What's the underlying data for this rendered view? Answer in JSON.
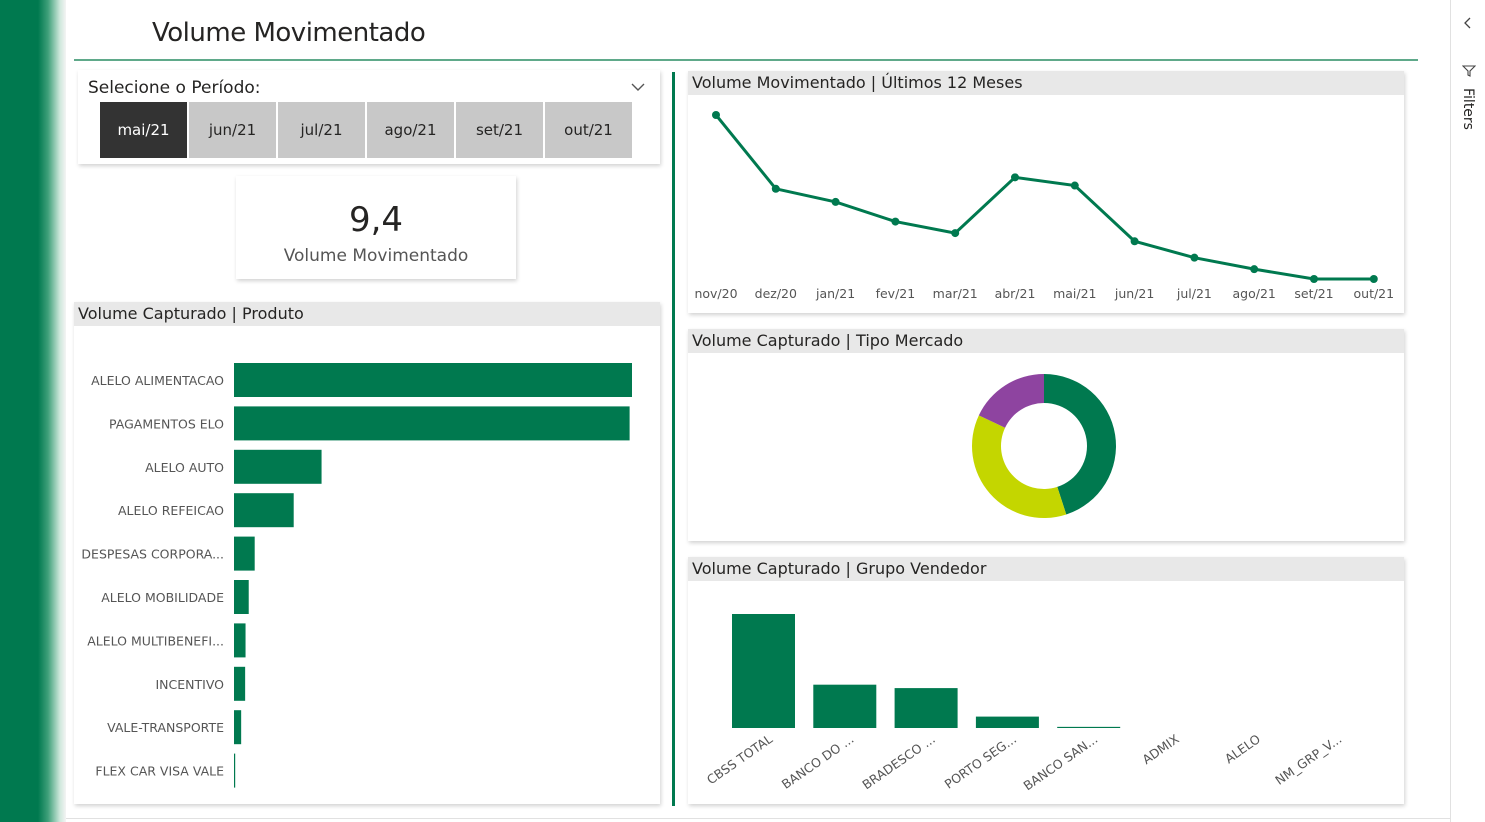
{
  "page": {
    "title": "Volume Movimentado"
  },
  "period_slicer": {
    "label": "Selecione o Período:",
    "options": [
      "mai/21",
      "jun/21",
      "jul/21",
      "ago/21",
      "set/21",
      "out/21"
    ],
    "selected": "mai/21"
  },
  "kpi": {
    "value": "9,4",
    "label": "Volume Movimentado"
  },
  "filters_pane": {
    "label": "Filters"
  },
  "colors": {
    "brand": "#00794f",
    "yellow_green": "#c4d600",
    "purple": "#8e44a0",
    "selected_button": "#333333"
  },
  "chart_data": [
    {
      "type": "bar",
      "orientation": "horizontal",
      "title": "Volume Capturado | Produto",
      "categories": [
        "ALELO ALIMENTACAO",
        "PAGAMENTOS ELO",
        "ALELO AUTO",
        "ALELO REFEICAO",
        "DESPESAS CORPORA...",
        "ALELO MOBILIDADE",
        "ALELO MULTIBENEFI...",
        "INCENTIVO",
        "VALE-TRANSPORTE",
        "FLEX CAR VISA VALE"
      ],
      "values": [
        100,
        99.4,
        22,
        15,
        5.2,
        3.7,
        2.9,
        2.8,
        1.8,
        0.3
      ],
      "xlim": [
        0,
        100
      ]
    },
    {
      "type": "line",
      "title": "Volume Movimentado | Últimos 12 Meses",
      "x": [
        "nov/20",
        "dez/20",
        "jan/21",
        "fev/21",
        "mar/21",
        "abr/21",
        "mai/21",
        "jun/21",
        "jul/21",
        "ago/21",
        "set/21",
        "out/21"
      ],
      "values": [
        100,
        55,
        47,
        35,
        28,
        62,
        57,
        23,
        13,
        6,
        0,
        0
      ],
      "ylim": [
        0,
        100
      ]
    },
    {
      "type": "pie",
      "subtype": "donut",
      "title": "Volume Capturado | Tipo Mercado",
      "slices": [
        {
          "value": 45,
          "color": "#00794f"
        },
        {
          "value": 37,
          "color": "#c4d600"
        },
        {
          "value": 18,
          "color": "#8e44a0"
        }
      ]
    },
    {
      "type": "bar",
      "orientation": "vertical",
      "title": "Volume Capturado | Grupo Vendedor",
      "categories": [
        "CBSS TOTAL",
        "BANCO DO ...",
        "BRADESCO ...",
        "PORTO SEG...",
        "BANCO SAN...",
        "ADMIX",
        "ALELO",
        "NM_GRP_V..."
      ],
      "values": [
        100,
        38,
        35,
        10,
        1,
        0,
        0,
        0
      ],
      "ylim": [
        0,
        100
      ]
    }
  ]
}
